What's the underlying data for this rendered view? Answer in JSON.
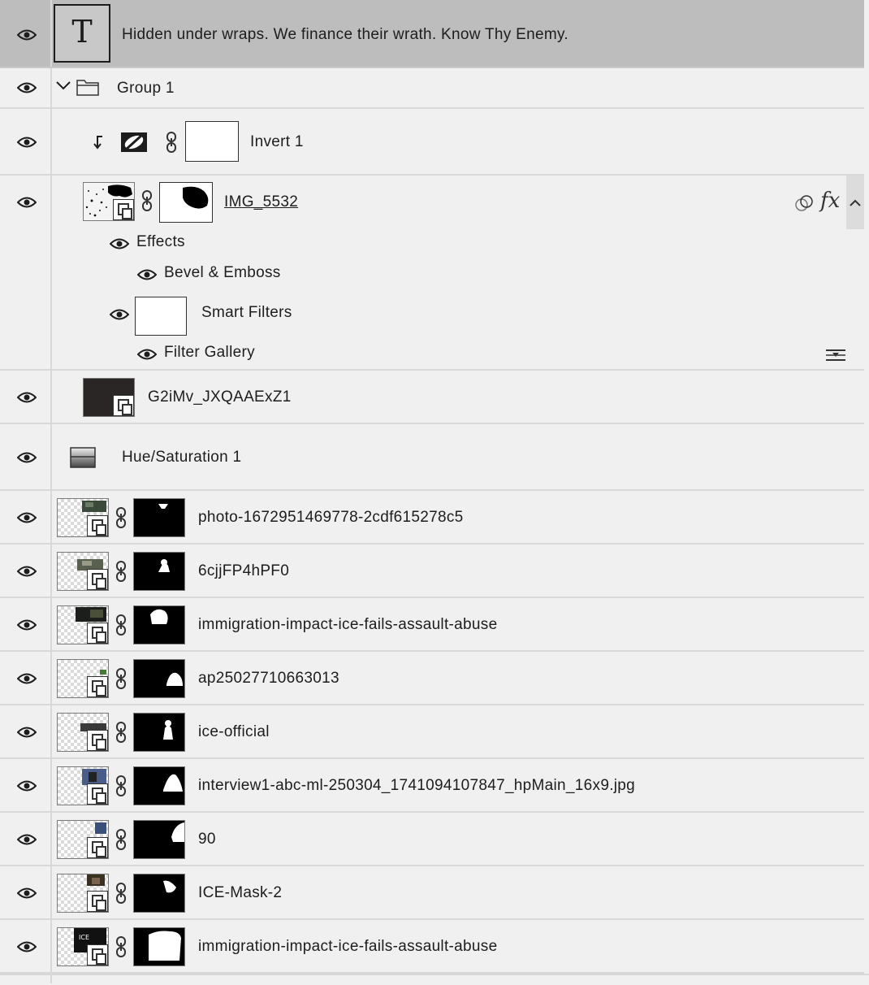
{
  "layers": {
    "type_layer": {
      "name": "Hidden under wraps. We finance their wrath. Know Thy Enemy.",
      "thumb_letter": "T",
      "selected": true
    },
    "group": {
      "name": "Group 1"
    },
    "invert": {
      "name": "Invert 1"
    },
    "img5532": {
      "name": "IMG_5532",
      "effects_label": "Effects",
      "bevel_label": "Bevel & Emboss",
      "smart_filters_label": "Smart Filters",
      "filter_gallery_label": "Filter Gallery",
      "fx_label": "fx"
    },
    "g2": {
      "name": "G2iMv_JXQAAExZ1"
    },
    "hue": {
      "name": "Hue/Saturation 1"
    },
    "masked": [
      {
        "name": "photo-1672951469778-2cdf615278c5"
      },
      {
        "name": "6cjjFP4hPF0"
      },
      {
        "name": "immigration-impact-ice-fails-assault-abuse"
      },
      {
        "name": "ap25027710663013"
      },
      {
        "name": "ice-official"
      },
      {
        "name": "interview1-abc-ml-250304_1741094107847_hpMain_16x9.jpg"
      },
      {
        "name": "90"
      },
      {
        "name": "ICE-Mask-2"
      },
      {
        "name": "immigration-impact-ice-fails-assault-abuse"
      }
    ]
  },
  "icons": {
    "visibility": "eye-icon",
    "group": "folder-icon",
    "disclosure": "chevron-down-icon",
    "adjustment": "invert-adjustment-icon",
    "clip": "clipping-arrow-icon",
    "link": "chain-link-icon",
    "smart_object": "smart-object-badge-icon",
    "filter_options": "filter-options-icon",
    "collapse": "chevron-up-icon",
    "blend": "blend-circles-icon",
    "hue_sat": "hue-saturation-icon"
  },
  "colors": {
    "panel_bg": "#f0f0f0",
    "selected_bg": "#bdbdbd",
    "divider": "#d8d8d8"
  }
}
